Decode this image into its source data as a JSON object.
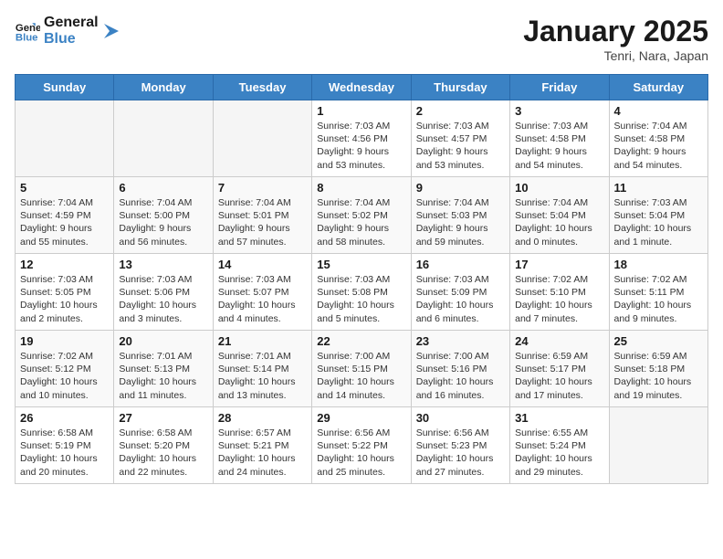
{
  "header": {
    "logo_line1": "General",
    "logo_line2": "Blue",
    "title": "January 2025",
    "subtitle": "Tenri, Nara, Japan"
  },
  "days_of_week": [
    "Sunday",
    "Monday",
    "Tuesday",
    "Wednesday",
    "Thursday",
    "Friday",
    "Saturday"
  ],
  "weeks": [
    [
      {
        "num": "",
        "info": "",
        "empty": true
      },
      {
        "num": "",
        "info": "",
        "empty": true
      },
      {
        "num": "",
        "info": "",
        "empty": true
      },
      {
        "num": "1",
        "info": "Sunrise: 7:03 AM\nSunset: 4:56 PM\nDaylight: 9 hours\nand 53 minutes."
      },
      {
        "num": "2",
        "info": "Sunrise: 7:03 AM\nSunset: 4:57 PM\nDaylight: 9 hours\nand 53 minutes."
      },
      {
        "num": "3",
        "info": "Sunrise: 7:03 AM\nSunset: 4:58 PM\nDaylight: 9 hours\nand 54 minutes."
      },
      {
        "num": "4",
        "info": "Sunrise: 7:04 AM\nSunset: 4:58 PM\nDaylight: 9 hours\nand 54 minutes."
      }
    ],
    [
      {
        "num": "5",
        "info": "Sunrise: 7:04 AM\nSunset: 4:59 PM\nDaylight: 9 hours\nand 55 minutes."
      },
      {
        "num": "6",
        "info": "Sunrise: 7:04 AM\nSunset: 5:00 PM\nDaylight: 9 hours\nand 56 minutes."
      },
      {
        "num": "7",
        "info": "Sunrise: 7:04 AM\nSunset: 5:01 PM\nDaylight: 9 hours\nand 57 minutes."
      },
      {
        "num": "8",
        "info": "Sunrise: 7:04 AM\nSunset: 5:02 PM\nDaylight: 9 hours\nand 58 minutes."
      },
      {
        "num": "9",
        "info": "Sunrise: 7:04 AM\nSunset: 5:03 PM\nDaylight: 9 hours\nand 59 minutes."
      },
      {
        "num": "10",
        "info": "Sunrise: 7:04 AM\nSunset: 5:04 PM\nDaylight: 10 hours\nand 0 minutes."
      },
      {
        "num": "11",
        "info": "Sunrise: 7:03 AM\nSunset: 5:04 PM\nDaylight: 10 hours\nand 1 minute."
      }
    ],
    [
      {
        "num": "12",
        "info": "Sunrise: 7:03 AM\nSunset: 5:05 PM\nDaylight: 10 hours\nand 2 minutes."
      },
      {
        "num": "13",
        "info": "Sunrise: 7:03 AM\nSunset: 5:06 PM\nDaylight: 10 hours\nand 3 minutes."
      },
      {
        "num": "14",
        "info": "Sunrise: 7:03 AM\nSunset: 5:07 PM\nDaylight: 10 hours\nand 4 minutes."
      },
      {
        "num": "15",
        "info": "Sunrise: 7:03 AM\nSunset: 5:08 PM\nDaylight: 10 hours\nand 5 minutes."
      },
      {
        "num": "16",
        "info": "Sunrise: 7:03 AM\nSunset: 5:09 PM\nDaylight: 10 hours\nand 6 minutes."
      },
      {
        "num": "17",
        "info": "Sunrise: 7:02 AM\nSunset: 5:10 PM\nDaylight: 10 hours\nand 7 minutes."
      },
      {
        "num": "18",
        "info": "Sunrise: 7:02 AM\nSunset: 5:11 PM\nDaylight: 10 hours\nand 9 minutes."
      }
    ],
    [
      {
        "num": "19",
        "info": "Sunrise: 7:02 AM\nSunset: 5:12 PM\nDaylight: 10 hours\nand 10 minutes."
      },
      {
        "num": "20",
        "info": "Sunrise: 7:01 AM\nSunset: 5:13 PM\nDaylight: 10 hours\nand 11 minutes."
      },
      {
        "num": "21",
        "info": "Sunrise: 7:01 AM\nSunset: 5:14 PM\nDaylight: 10 hours\nand 13 minutes."
      },
      {
        "num": "22",
        "info": "Sunrise: 7:00 AM\nSunset: 5:15 PM\nDaylight: 10 hours\nand 14 minutes."
      },
      {
        "num": "23",
        "info": "Sunrise: 7:00 AM\nSunset: 5:16 PM\nDaylight: 10 hours\nand 16 minutes."
      },
      {
        "num": "24",
        "info": "Sunrise: 6:59 AM\nSunset: 5:17 PM\nDaylight: 10 hours\nand 17 minutes."
      },
      {
        "num": "25",
        "info": "Sunrise: 6:59 AM\nSunset: 5:18 PM\nDaylight: 10 hours\nand 19 minutes."
      }
    ],
    [
      {
        "num": "26",
        "info": "Sunrise: 6:58 AM\nSunset: 5:19 PM\nDaylight: 10 hours\nand 20 minutes."
      },
      {
        "num": "27",
        "info": "Sunrise: 6:58 AM\nSunset: 5:20 PM\nDaylight: 10 hours\nand 22 minutes."
      },
      {
        "num": "28",
        "info": "Sunrise: 6:57 AM\nSunset: 5:21 PM\nDaylight: 10 hours\nand 24 minutes."
      },
      {
        "num": "29",
        "info": "Sunrise: 6:56 AM\nSunset: 5:22 PM\nDaylight: 10 hours\nand 25 minutes."
      },
      {
        "num": "30",
        "info": "Sunrise: 6:56 AM\nSunset: 5:23 PM\nDaylight: 10 hours\nand 27 minutes."
      },
      {
        "num": "31",
        "info": "Sunrise: 6:55 AM\nSunset: 5:24 PM\nDaylight: 10 hours\nand 29 minutes."
      },
      {
        "num": "",
        "info": "",
        "empty": true
      }
    ]
  ]
}
